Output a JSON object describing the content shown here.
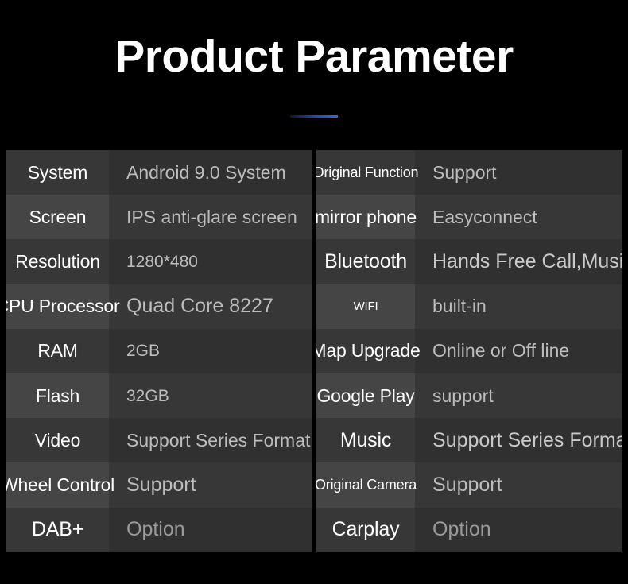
{
  "header": {
    "title": "Product Parameter",
    "accent_color": "#2148c4"
  },
  "theme": {
    "background": "#000000",
    "label_cell_light": "#454545",
    "label_cell_dark": "#373737",
    "value_cell_light": "#373737",
    "value_cell_dark": "#303030",
    "label_text_color": "#ffffff",
    "value_text_color": "#b9b9b9"
  },
  "tables": {
    "left": {
      "rows": [
        {
          "label": "System",
          "value": "Android 9.0 System",
          "label_size": "l",
          "value_size": "l",
          "value_tone": "normal"
        },
        {
          "label": "Screen",
          "value": "IPS anti-glare screen",
          "label_size": "l",
          "value_size": "l",
          "value_tone": "normal"
        },
        {
          "label": "Resolution",
          "value": "1280*480",
          "label_size": "l",
          "value_size": "m",
          "value_tone": "normal"
        },
        {
          "label": "CPU Processor",
          "value": "Quad Core 8227",
          "label_size": "l",
          "value_size": "xl",
          "value_tone": "normal"
        },
        {
          "label": "RAM",
          "value": "2GB",
          "label_size": "l",
          "value_size": "m",
          "value_tone": "normal"
        },
        {
          "label": "Flash",
          "value": "32GB",
          "label_size": "l",
          "value_size": "m",
          "value_tone": "normal"
        },
        {
          "label": "Video",
          "value": "Support Series Format",
          "label_size": "l",
          "value_size": "l",
          "value_tone": "normal"
        },
        {
          "label": "Wheel Control",
          "value": "Support",
          "label_size": "l",
          "value_size": "xl",
          "value_tone": "normal"
        },
        {
          "label": "DAB+",
          "value": "Option",
          "label_size": "xl",
          "value_size": "xl",
          "value_tone": "dim"
        }
      ]
    },
    "right": {
      "rows": [
        {
          "label": "Original Function",
          "value": "Support",
          "label_size": "s",
          "value_size": "l",
          "value_tone": "normal"
        },
        {
          "label": "mirror phone",
          "value": "Easyconnect",
          "label_size": "l",
          "value_size": "l",
          "value_tone": "normal"
        },
        {
          "label": "Bluetooth",
          "value": "Hands Free Call,Music",
          "label_size": "xl",
          "value_size": "xl",
          "value_tone": "bright"
        },
        {
          "label": "WIFI",
          "value": "built-in",
          "label_size": "xs",
          "value_size": "l",
          "value_tone": "normal"
        },
        {
          "label": "Map Upgrade",
          "value": "Online or Off line",
          "label_size": "l",
          "value_size": "l",
          "value_tone": "normal"
        },
        {
          "label": "Google Play",
          "value": " support",
          "label_size": "l",
          "value_size": "l",
          "value_tone": "normal"
        },
        {
          "label": "Music",
          "value": "Support Series Format",
          "label_size": "xl",
          "value_size": "xl",
          "value_tone": "bright"
        },
        {
          "label": "Original Camera",
          "value": "Support",
          "label_size": "s",
          "value_size": "xl",
          "value_tone": "normal"
        },
        {
          "label": "Carplay",
          "value": "Option",
          "label_size": "xl",
          "value_size": "xl",
          "value_tone": "dim"
        }
      ]
    }
  }
}
